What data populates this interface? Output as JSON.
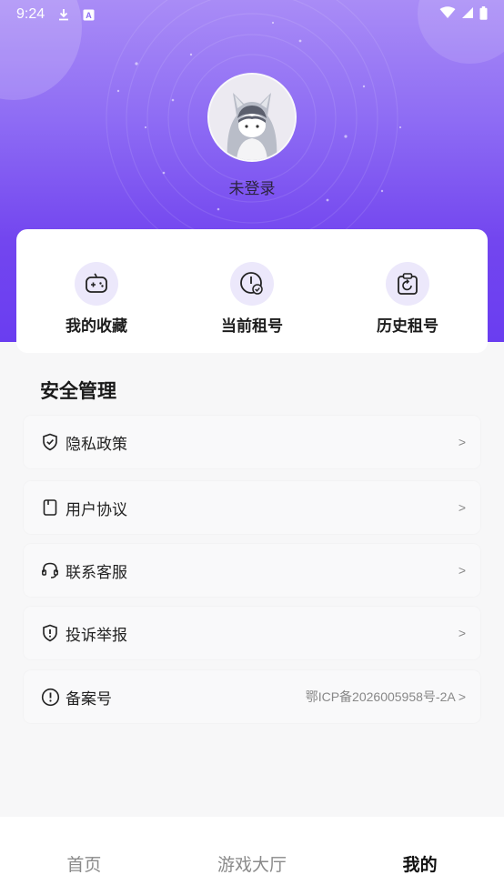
{
  "status_bar": {
    "time": "9:24",
    "left_icons": [
      "download-icon",
      "keyboard-a-icon"
    ],
    "right_icons": [
      "wifi-icon",
      "signal-icon",
      "battery-icon"
    ]
  },
  "profile": {
    "avatar_icon": "cat-hood-avatar-icon",
    "login_text": "未登录"
  },
  "quick_actions": [
    {
      "label": "我的收藏",
      "icon": "gamepad-icon"
    },
    {
      "label": "当前租号",
      "icon": "clock-check-icon"
    },
    {
      "label": "历史租号",
      "icon": "clipboard-refresh-icon"
    }
  ],
  "security": {
    "title": "安全管理",
    "items": [
      {
        "label": "隐私政策",
        "icon": "shield-check-icon",
        "right": ">"
      },
      {
        "label": "用户协议",
        "icon": "document-icon",
        "right": ">"
      },
      {
        "label": "联系客服",
        "icon": "headset-icon",
        "right": ">"
      },
      {
        "label": "投诉举报",
        "icon": "shield-alert-icon",
        "right": ">"
      },
      {
        "label": "备案号",
        "icon": "info-circle-icon",
        "right": "鄂ICP备2026005958号-2A >"
      }
    ]
  },
  "bottom_nav": {
    "items": [
      "首页",
      "游戏大厅",
      "我的"
    ],
    "active_index": 2
  },
  "colors": {
    "accent": "#7346ef",
    "icon_bg": "#ece8fb"
  }
}
